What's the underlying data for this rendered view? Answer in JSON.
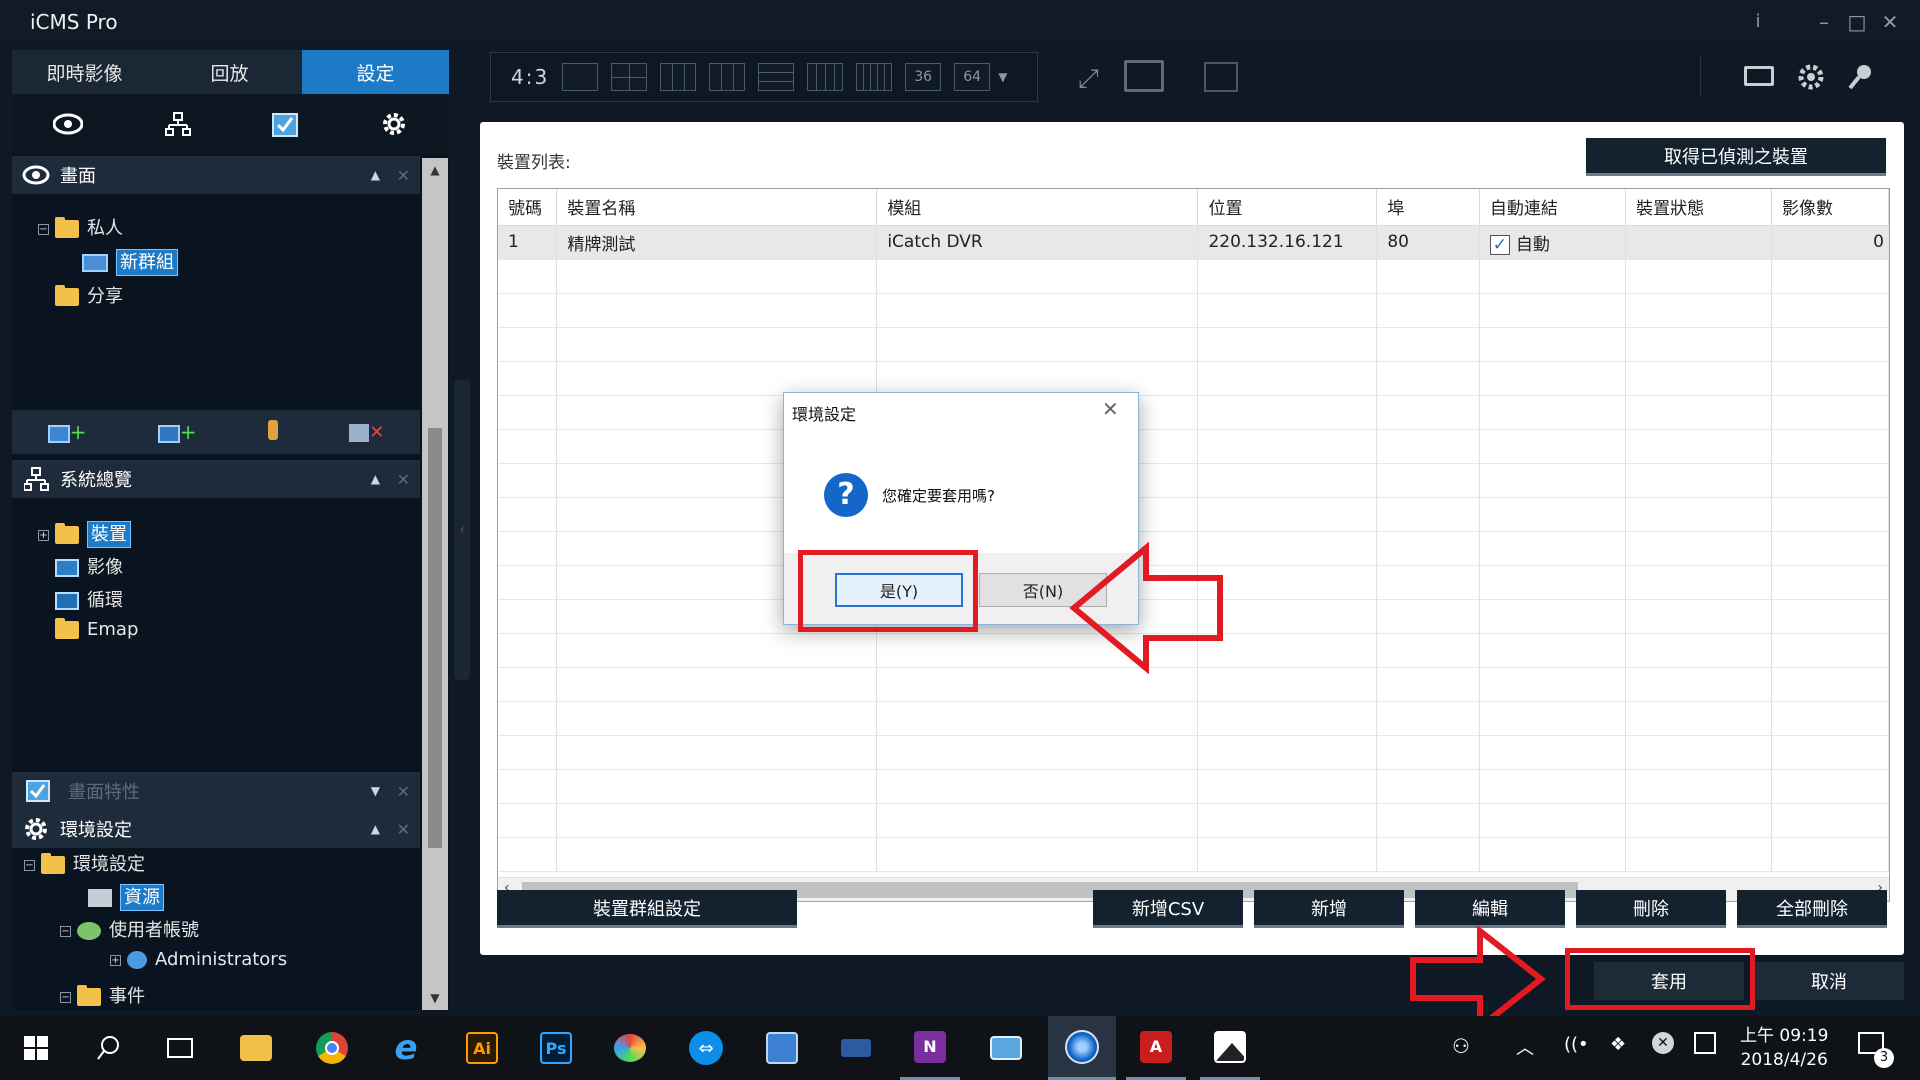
{
  "app": {
    "title": "iCMS Pro",
    "info_glyph": "i"
  },
  "left_tabs": [
    {
      "label": "即時影像"
    },
    {
      "label": "回放"
    },
    {
      "label": "設定",
      "active": true
    }
  ],
  "panel_icons": [
    "eye-icon",
    "network-icon",
    "checklist-icon",
    "gear-icon"
  ],
  "screens_section": {
    "title": "畫面",
    "tree": [
      {
        "label": "私人"
      },
      {
        "label": "新群組"
      },
      {
        "label": "分享"
      }
    ]
  },
  "overview_section": {
    "title": "系統總覽",
    "tree": [
      {
        "label": "裝置"
      },
      {
        "label": "影像"
      },
      {
        "label": "循環"
      },
      {
        "label": "Emap"
      }
    ]
  },
  "screen_props": {
    "title": "畫面特性"
  },
  "env_section": {
    "title": "環境設定",
    "tree": [
      {
        "label": "環境設定"
      },
      {
        "label": "資源"
      },
      {
        "label": "使用者帳號"
      },
      {
        "label": "Administrators"
      },
      {
        "label": "事件"
      }
    ]
  },
  "toolbar": {
    "ratio": "4:3",
    "layout_36": "36",
    "layout_64": "64"
  },
  "main": {
    "device_list_label": "裝置列表:",
    "get_detected_button": "取得已偵測之裝置",
    "columns": [
      "號碼",
      "裝置名稱",
      "模組",
      "位置",
      "埠",
      "自動連結",
      "裝置狀態",
      "影像數"
    ],
    "rows": [
      {
        "num": "1",
        "name": "精牌測試",
        "model": "iCatch DVR",
        "location": "220.132.16.121",
        "port": "80",
        "auto_connect": "自動",
        "auto_checked": true,
        "status": "",
        "video_count": "0"
      }
    ],
    "buttons": {
      "group_settings": "裝置群組設定",
      "add_csv": "新增CSV",
      "add": "新增",
      "edit": "編輯",
      "delete": "刪除",
      "delete_all": "全部刪除"
    }
  },
  "footer": {
    "apply": "套用",
    "cancel": "取消"
  },
  "dialog": {
    "title": "環境設定",
    "message": "您確定要套用嗎?",
    "yes": "是(Y)",
    "no": "否(N)"
  },
  "taskbar": {
    "time": "上午 09:19",
    "date": "2018/4/26",
    "notification_count": "3",
    "apps": [
      "windows-start",
      "search",
      "task-view",
      "file-explorer",
      "chrome",
      "internet-explorer",
      "illustrator",
      "photoshop",
      "paint",
      "teamviewer",
      "remote-desktop",
      "video",
      "onenote",
      "control-panel",
      "icms",
      "acrobat",
      "photos"
    ],
    "illustrator_label": "Ai",
    "photoshop_label": "Ps"
  },
  "colors": {
    "accent": "#1c7ac7",
    "highlight_red": "#e21a22",
    "background": "#0f1925"
  }
}
